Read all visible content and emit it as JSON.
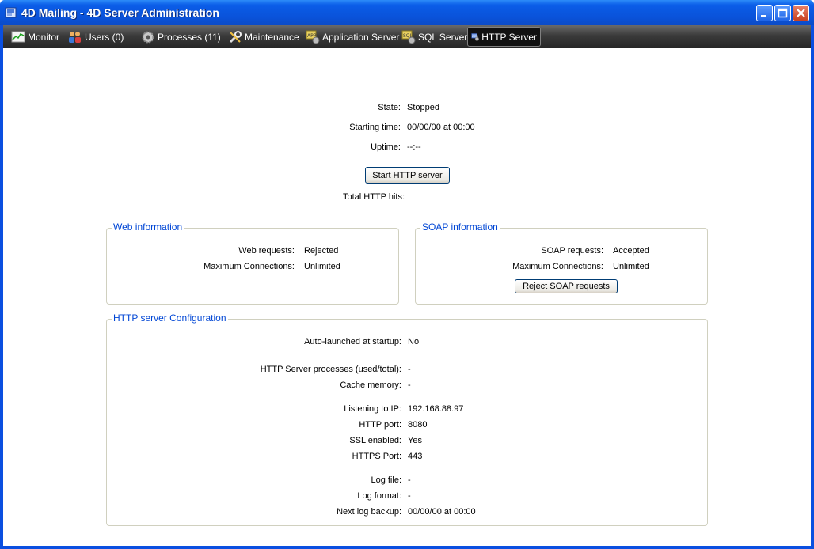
{
  "window": {
    "title": "4D Mailing - 4D Server Administration"
  },
  "tabs": [
    {
      "label": "Monitor",
      "icon": "monitor-icon"
    },
    {
      "label": "Users (0)",
      "icon": "users-icon"
    },
    {
      "label": "Processes (11)",
      "icon": "gear-icon"
    },
    {
      "label": "Maintenance",
      "icon": "wrench-icon"
    },
    {
      "label": "Application Server",
      "icon": "app-server-icon"
    },
    {
      "label": "SQL Server",
      "icon": "sql-server-icon"
    },
    {
      "label": "HTTP Server",
      "icon": "web-server-icon"
    }
  ],
  "status": {
    "state_label": "State:",
    "state_value": "Stopped",
    "starting_label": "Starting time:",
    "starting_value": "00/00/00 at 00:00",
    "uptime_label": "Uptime:",
    "uptime_value": "--:--",
    "start_button": "Start HTTP server",
    "hits_label": "Total HTTP hits:",
    "hits_value": ""
  },
  "web_info": {
    "title": "Web information",
    "requests_label": "Web requests:",
    "requests_value": "Rejected",
    "maxconn_label": "Maximum Connections:",
    "maxconn_value": "Unlimited"
  },
  "soap_info": {
    "title": "SOAP information",
    "requests_label": "SOAP requests:",
    "requests_value": "Accepted",
    "maxconn_label": "Maximum Connections:",
    "maxconn_value": "Unlimited",
    "reject_button": "Reject SOAP requests"
  },
  "config": {
    "title": "HTTP server Configuration",
    "rows": [
      {
        "label": "Auto-launched at startup:",
        "value": "No"
      },
      {
        "label": "HTTP Server processes (used/total):",
        "value": "-"
      },
      {
        "label": "Cache memory:",
        "value": "-"
      },
      {
        "label": "Listening to IP:",
        "value": "192.168.88.97"
      },
      {
        "label": "HTTP port:",
        "value": "8080"
      },
      {
        "label": "SSL enabled:",
        "value": "Yes"
      },
      {
        "label": "HTTPS Port:",
        "value": "443"
      },
      {
        "label": "Log file:",
        "value": "-"
      },
      {
        "label": "Log format:",
        "value": "-"
      },
      {
        "label": "Next log backup:",
        "value": "00/00/00 at 00:00"
      }
    ]
  },
  "colors": {
    "titlebar": "#0a52d9",
    "group_title": "#0046d5",
    "tabbar": "#3a3a3a"
  }
}
